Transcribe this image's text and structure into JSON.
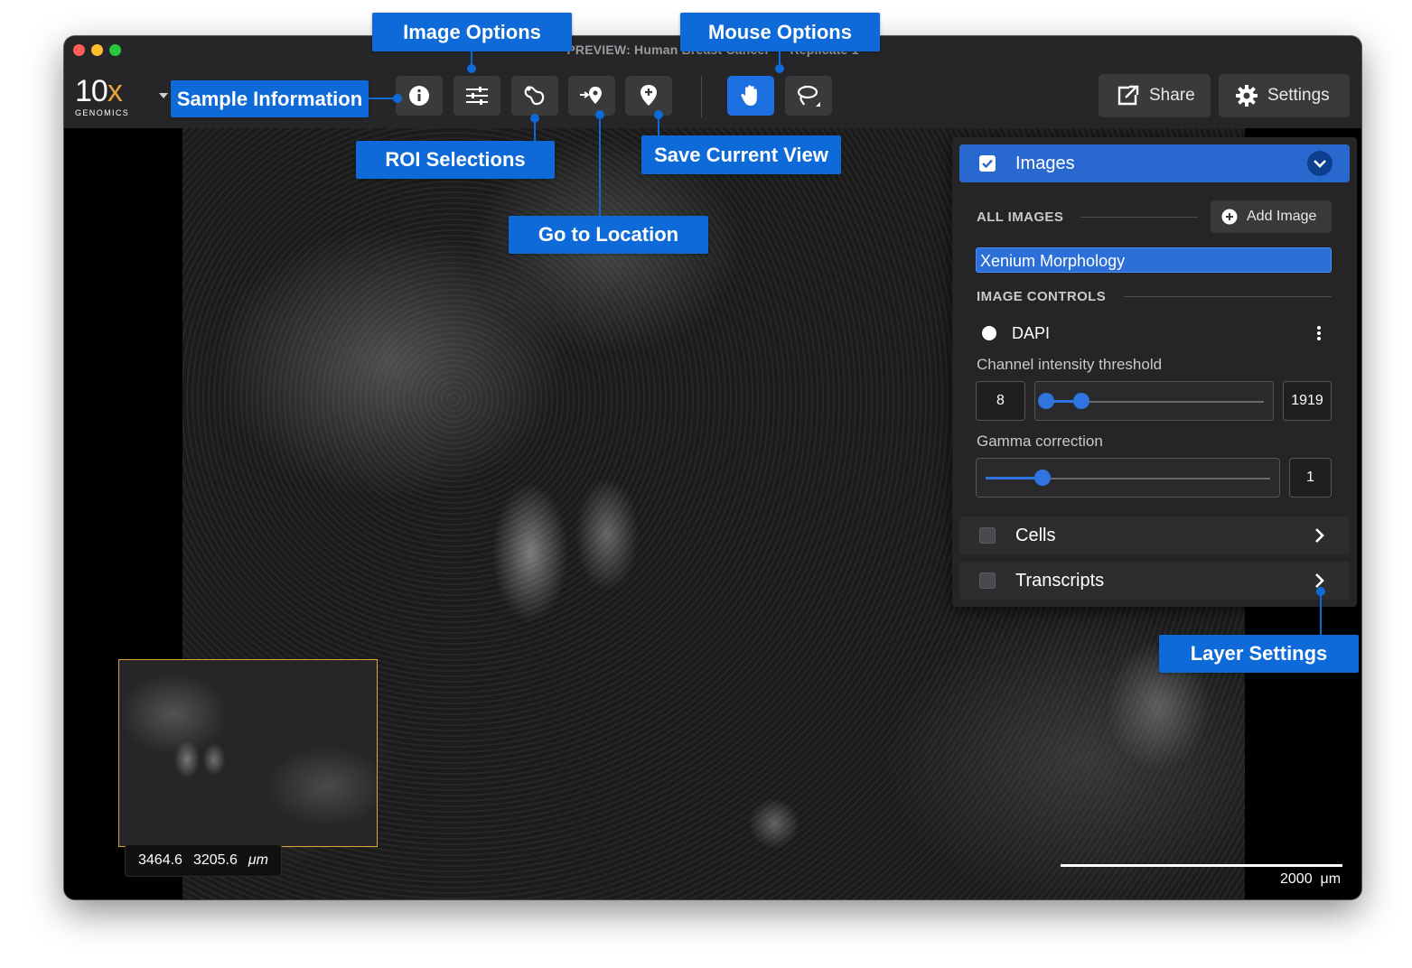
{
  "window": {
    "title": "PREVIEW: Human Breast Cancer — Replicate 1"
  },
  "logo": {
    "main": "10",
    "x": "x",
    "sub": "GENOMICS"
  },
  "toolbar": {
    "share_label": "Share",
    "settings_label": "Settings"
  },
  "callouts": {
    "image_options": "Image Options",
    "mouse_options": "Mouse Options",
    "sample_information": "Sample Information",
    "roi_selections": "ROI Selections",
    "save_current_view": "Save Current View",
    "go_to_location": "Go to Location",
    "layer_settings": "Layer Settings"
  },
  "panel": {
    "images_label": "Images",
    "all_images_label": "ALL IMAGES",
    "add_image_label": "Add Image",
    "selected_image": "Xenium Morphology",
    "image_controls_label": "IMAGE CONTROLS",
    "channel_name": "DAPI",
    "threshold_label": "Channel intensity threshold",
    "threshold_min": "8",
    "threshold_max": "1919",
    "threshold_low_fraction": 0.0,
    "threshold_high_fraction": 0.16,
    "gamma_label": "Gamma correction",
    "gamma_value": "1",
    "gamma_fraction": 0.2,
    "cells_label": "Cells",
    "transcripts_label": "Transcripts"
  },
  "viewer": {
    "coord_x": "3464.6",
    "coord_y": "3205.6",
    "coord_unit": "μm",
    "scale_label": "2000  μm"
  },
  "colors": {
    "accent": "#1c6fe0",
    "callout": "#0d6ad8",
    "minimap_border": "#e2a33d"
  }
}
